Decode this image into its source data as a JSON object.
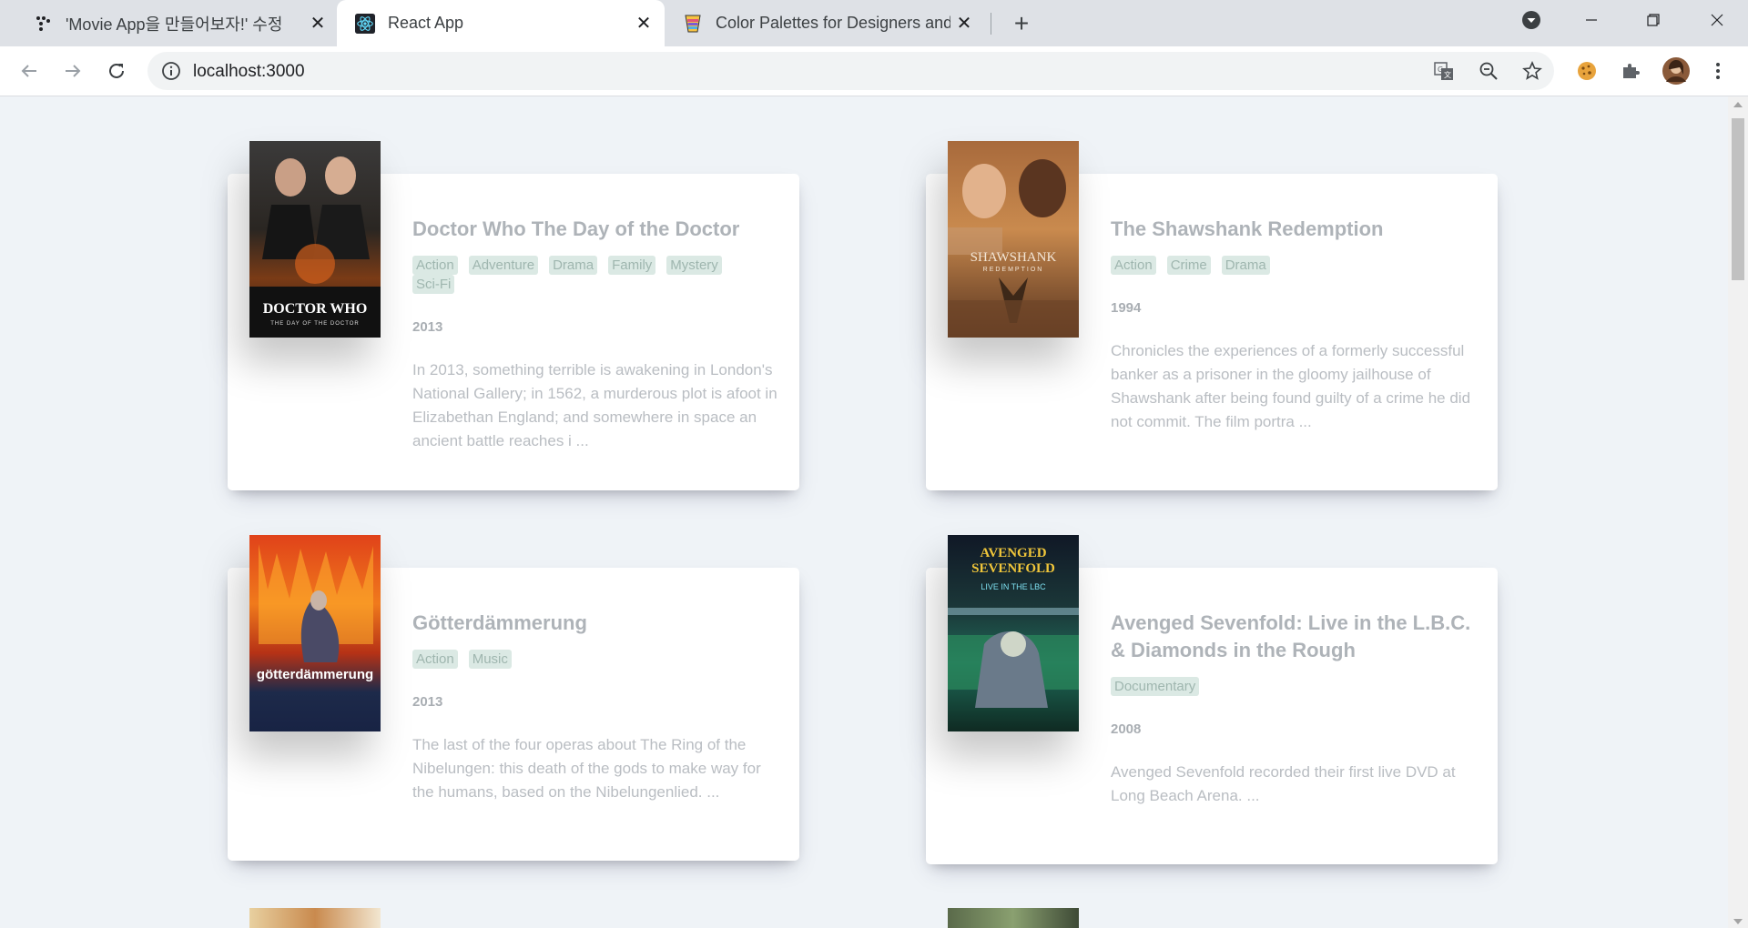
{
  "browser": {
    "tabs": [
      {
        "title": "'Movie App을 만들어보자!' 수정",
        "icon": "dots-logo-icon",
        "active": false
      },
      {
        "title": "React App",
        "icon": "react-logo-icon",
        "active": true
      },
      {
        "title": "Color Palettes for Designers and",
        "icon": "palette-cup-icon",
        "active": false
      }
    ],
    "url": "localhost:3000"
  },
  "movies": [
    {
      "title": "Doctor Who The Day of the Doctor",
      "genres": [
        "Action",
        "Adventure",
        "Drama",
        "Family",
        "Mystery",
        "Sci-Fi"
      ],
      "year": "2013",
      "summary": "In 2013, something terrible is awakening in London's National Gallery; in 1562, a murderous plot is afoot in Elizabethan England; and somewhere in space an ancient battle reaches i ...",
      "poster_text": "DOCTOR WHO",
      "poster_sub": "THE DAY OF THE DOCTOR"
    },
    {
      "title": "The Shawshank Redemption",
      "genres": [
        "Action",
        "Crime",
        "Drama"
      ],
      "year": "1994",
      "summary": "Chronicles the experiences of a formerly successful banker as a prisoner in the gloomy jailhouse of Shawshank after being found guilty of a crime he did not commit. The film portra ...",
      "poster_text": "SHAWSHANK",
      "poster_sub": "REDEMPTION"
    },
    {
      "title": "Götterdämmerung",
      "genres": [
        "Action",
        "Music"
      ],
      "year": "2013",
      "summary": "The last of the four operas about The Ring of the Nibelungen: this death of the gods to make way for the humans, based on the Nibelungenlied. ...",
      "poster_text": "götterdämmerung",
      "poster_sub": ""
    },
    {
      "title": "Avenged Sevenfold: Live in the L.B.C. & Diamonds in the Rough",
      "genres": [
        "Documentary"
      ],
      "year": "2008",
      "summary": "Avenged Sevenfold recorded their first live DVD at Long Beach Arena. ...",
      "poster_text": "AVENGED SEVENFOLD",
      "poster_sub": "LIVE IN THE LBC"
    }
  ],
  "colors": {
    "page_bg": "#eff3f7",
    "card_bg": "#ffffff",
    "title": "#aeb3b8",
    "genre_bg": "#dbe9e4",
    "genre_text": "#9fb6af"
  }
}
